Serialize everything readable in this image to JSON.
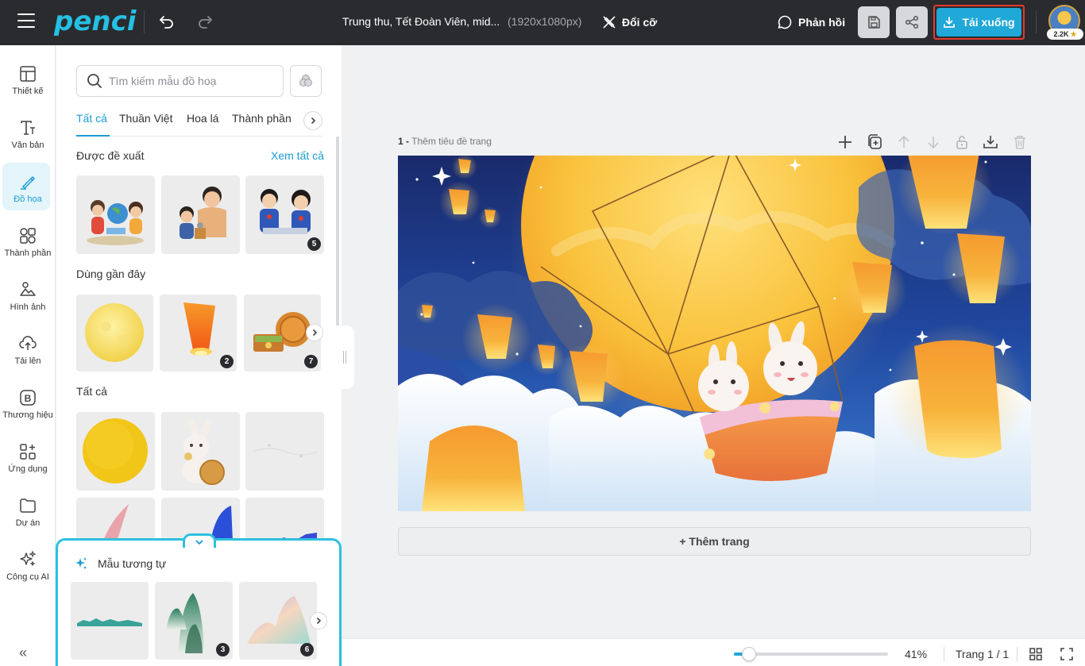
{
  "topbar": {
    "logo": "penci",
    "doc_title": "Trung thu, Tết Đoàn Viên, mid...",
    "doc_dims": "(1920x1080px)",
    "resize_label": "Đổi cỡ",
    "feedback_label": "Phản hồi",
    "download_label": "Tải xuống",
    "avatar_badge": "2.2K",
    "accent": "#1fa8d8"
  },
  "rail": {
    "items": [
      {
        "label": "Thiết kế",
        "icon": "layout-icon"
      },
      {
        "label": "Văn bản",
        "icon": "text-icon"
      },
      {
        "label": "Đồ họa",
        "icon": "pen-icon"
      },
      {
        "label": "Thành phần",
        "icon": "shapes-icon"
      },
      {
        "label": "Hình ảnh",
        "icon": "image-icon"
      },
      {
        "label": "Tải lên",
        "icon": "upload-icon"
      },
      {
        "label": "Thương hiệu",
        "icon": "brand-icon"
      },
      {
        "label": "Ứng dụng",
        "icon": "apps-icon"
      },
      {
        "label": "Dự án",
        "icon": "folder-icon"
      },
      {
        "label": "Công cụ AI",
        "icon": "sparkle-icon"
      }
    ],
    "active_index": 2,
    "collapse_label": "«"
  },
  "panel": {
    "search_placeholder": "Tìm kiếm mẫu đồ hoạ",
    "tabs": [
      "Tất cả",
      "Thuần Việt",
      "Hoa lá",
      "Thành phần"
    ],
    "active_tab": 0,
    "sections": {
      "recommended": "Được đề xuất",
      "recent": "Dùng gần đây",
      "all": "Tất cả"
    },
    "see_all": "Xem tất cả",
    "recommended_badges": [
      "",
      "",
      "5"
    ],
    "recent_badges": [
      "",
      "2",
      "7"
    ]
  },
  "similar": {
    "title": "Mẫu tương tự",
    "badges": [
      "",
      "3",
      "6"
    ]
  },
  "canvas": {
    "page_number": "1 -",
    "page_title_placeholder": "Thêm tiêu đề trang",
    "add_page_label": "+ Thêm trang"
  },
  "bottombar": {
    "zoom": "41%",
    "zoom_fraction": 0.1,
    "page_count": "Trang 1 / 1"
  }
}
